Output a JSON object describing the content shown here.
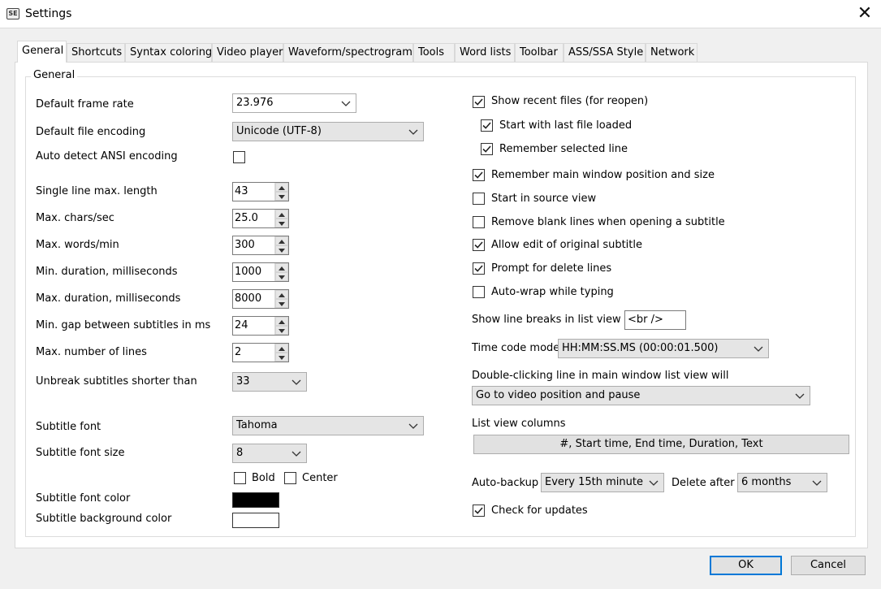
{
  "window": {
    "title": "Settings",
    "app_icon_text": "SE"
  },
  "tabs": [
    "General",
    "Shortcuts",
    "Syntax coloring",
    "Video player",
    "Waveform/spectrogram",
    "Tools",
    "Word lists",
    "Toolbar",
    "ASS/SSA Style",
    "Network"
  ],
  "active_tab": "General",
  "group_title": "General",
  "left": {
    "default_frame_rate": {
      "label": "Default frame rate",
      "value": "23.976"
    },
    "default_file_encoding": {
      "label": "Default file encoding",
      "value": "Unicode (UTF-8)"
    },
    "auto_detect_ansi": {
      "label": "Auto detect ANSI encoding",
      "checked": false
    },
    "single_line_max_length": {
      "label": "Single line max. length",
      "value": "43"
    },
    "max_chars_sec": {
      "label": "Max. chars/sec",
      "value": "25.0"
    },
    "max_words_min": {
      "label": "Max. words/min",
      "value": "300"
    },
    "min_duration": {
      "label": "Min. duration, milliseconds",
      "value": "1000"
    },
    "max_duration": {
      "label": "Max. duration, milliseconds",
      "value": "8000"
    },
    "min_gap": {
      "label": "Min. gap between subtitles in ms",
      "value": "24"
    },
    "max_lines": {
      "label": "Max. number of lines",
      "value": "2"
    },
    "unbreak_shorter": {
      "label": "Unbreak subtitles shorter than",
      "value": "33"
    },
    "subtitle_font": {
      "label": "Subtitle font",
      "value": "Tahoma"
    },
    "subtitle_font_size": {
      "label": "Subtitle font size",
      "value": "8"
    },
    "bold": {
      "label": "Bold",
      "checked": false
    },
    "center": {
      "label": "Center",
      "checked": false
    },
    "subtitle_font_color": {
      "label": "Subtitle font color",
      "color": "#000000"
    },
    "subtitle_background_color": {
      "label": "Subtitle background color",
      "color": "#ffffff"
    }
  },
  "right": {
    "checkboxes": [
      {
        "label": "Show recent files (for reopen)",
        "checked": true
      },
      {
        "label": "Start with last file loaded",
        "checked": true
      },
      {
        "label": "Remember selected line",
        "checked": true
      },
      {
        "label": "Remember main window position and size",
        "checked": true
      },
      {
        "label": "Start in source view",
        "checked": false
      },
      {
        "label": "Remove blank lines when opening a subtitle",
        "checked": false
      },
      {
        "label": "Allow edit of original subtitle",
        "checked": true
      },
      {
        "label": "Prompt for delete lines",
        "checked": true
      },
      {
        "label": "Auto-wrap while typing",
        "checked": false
      }
    ],
    "line_breaks": {
      "label": "Show line breaks in list view as",
      "value": "<br />"
    },
    "time_code_mode": {
      "label": "Time code mode",
      "value": "HH:MM:SS.MS (00:00:01.500)"
    },
    "double_click": {
      "label": "Double-clicking line in main window list view will",
      "value": "Go to video position and pause"
    },
    "list_view_columns": {
      "label": "List view columns",
      "button": "#, Start time, End time, Duration, Text"
    },
    "auto_backup": {
      "label": "Auto-backup",
      "value": "Every 15th minute"
    },
    "delete_after": {
      "label": "Delete after",
      "value": "6 months"
    },
    "check_updates": {
      "label": "Check for updates",
      "checked": true
    }
  },
  "buttons": {
    "ok": "OK",
    "cancel": "Cancel"
  },
  "colors": {
    "accent": "#0078d7",
    "panel": "#ffffff",
    "background": "#f0f0f0"
  }
}
